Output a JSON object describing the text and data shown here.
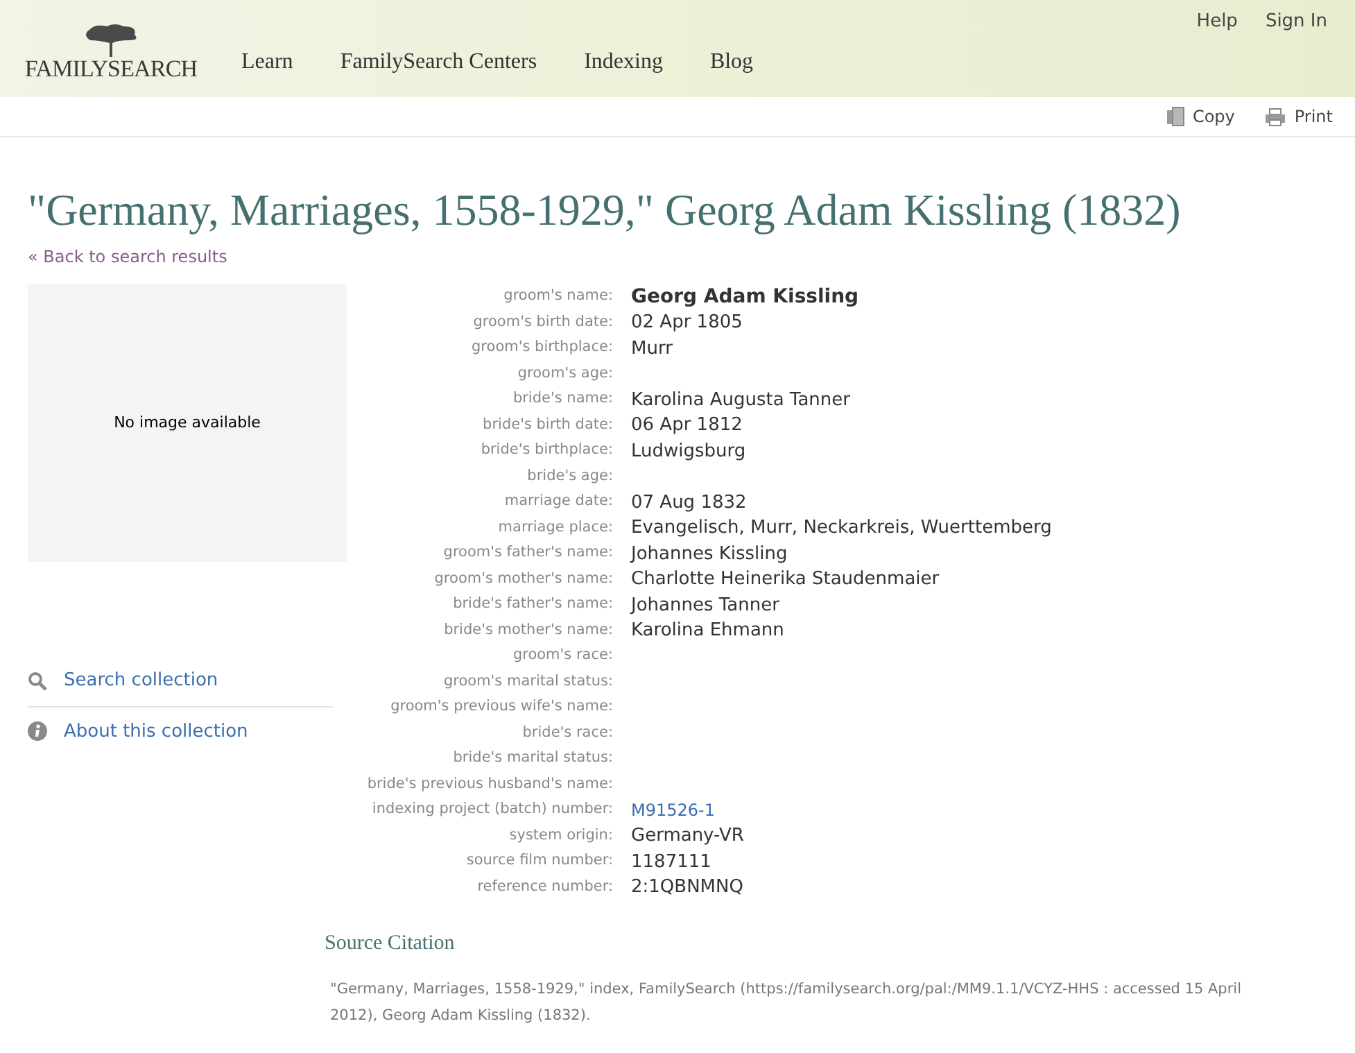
{
  "header": {
    "logo": "FAMILYSEARCH",
    "nav": [
      "Learn",
      "FamilySearch Centers",
      "Indexing",
      "Blog"
    ],
    "utility_links": [
      "Help",
      "Sign In"
    ]
  },
  "toolbar": [
    {
      "kind": "copy",
      "label": "Copy"
    },
    {
      "kind": "print",
      "label": "Print"
    }
  ],
  "title": "\"Germany, Marriages, 1558-1929,\" Georg Adam Kissling (1832)",
  "back_link": "« Back to search results",
  "image_placeholder": "No image available",
  "sidebar_links": [
    {
      "kind": "search",
      "label": "Search collection"
    },
    {
      "kind": "info",
      "label": "About this collection"
    }
  ],
  "fields": [
    {
      "label": "groom's name:",
      "value": "Georg Adam Kissling",
      "kind": "name"
    },
    {
      "label": "groom's birth date:",
      "value": "02 Apr 1805",
      "kind": "text"
    },
    {
      "label": "groom's birthplace:",
      "value": "Murr",
      "kind": "text"
    },
    {
      "label": "groom's age:"
    },
    {
      "label": "bride's name:",
      "value": "Karolina Augusta Tanner",
      "kind": "text"
    },
    {
      "label": "bride's birth date:",
      "value": "06 Apr 1812",
      "kind": "text"
    },
    {
      "label": "bride's birthplace:",
      "value": "Ludwigsburg",
      "kind": "text"
    },
    {
      "label": "bride's age:"
    },
    {
      "label": "marriage date:",
      "value": "07 Aug 1832",
      "kind": "text"
    },
    {
      "label": "marriage place:",
      "value": "Evangelisch, Murr, Neckarkreis, Wuerttemberg",
      "kind": "text"
    },
    {
      "label": "groom's father's name:",
      "value": "Johannes Kissling",
      "kind": "text"
    },
    {
      "label": "groom's mother's name:",
      "value": "Charlotte Heinerika Staudenmaier",
      "kind": "text"
    },
    {
      "label": "bride's father's name:",
      "value": "Johannes Tanner",
      "kind": "text"
    },
    {
      "label": "bride's mother's name:",
      "value": "Karolina Ehmann",
      "kind": "text"
    },
    {
      "label": "groom's race:"
    },
    {
      "label": "groom's marital status:"
    },
    {
      "label": "groom's previous wife's name:"
    },
    {
      "label": "bride's race:"
    },
    {
      "label": "bride's marital status:"
    },
    {
      "label": "bride's previous husband's name:"
    },
    {
      "label": "indexing project (batch) number:",
      "value": "M91526-1",
      "kind": "link"
    },
    {
      "label": "system origin:",
      "value": "Germany-VR",
      "kind": "text"
    },
    {
      "label": "source film number:",
      "value": "1187111",
      "kind": "text"
    },
    {
      "label": "reference number:",
      "value": "2:1QBNMNQ",
      "kind": "text"
    }
  ],
  "source_citation": {
    "heading": "Source Citation",
    "text": "\"Germany, Marriages, 1558-1929,\" index, FamilySearch (https://familysearch.org/pal:/MM9.1.1/VCYZ-HHS : accessed 15 April 2012), Georg Adam Kissling (1832)."
  }
}
